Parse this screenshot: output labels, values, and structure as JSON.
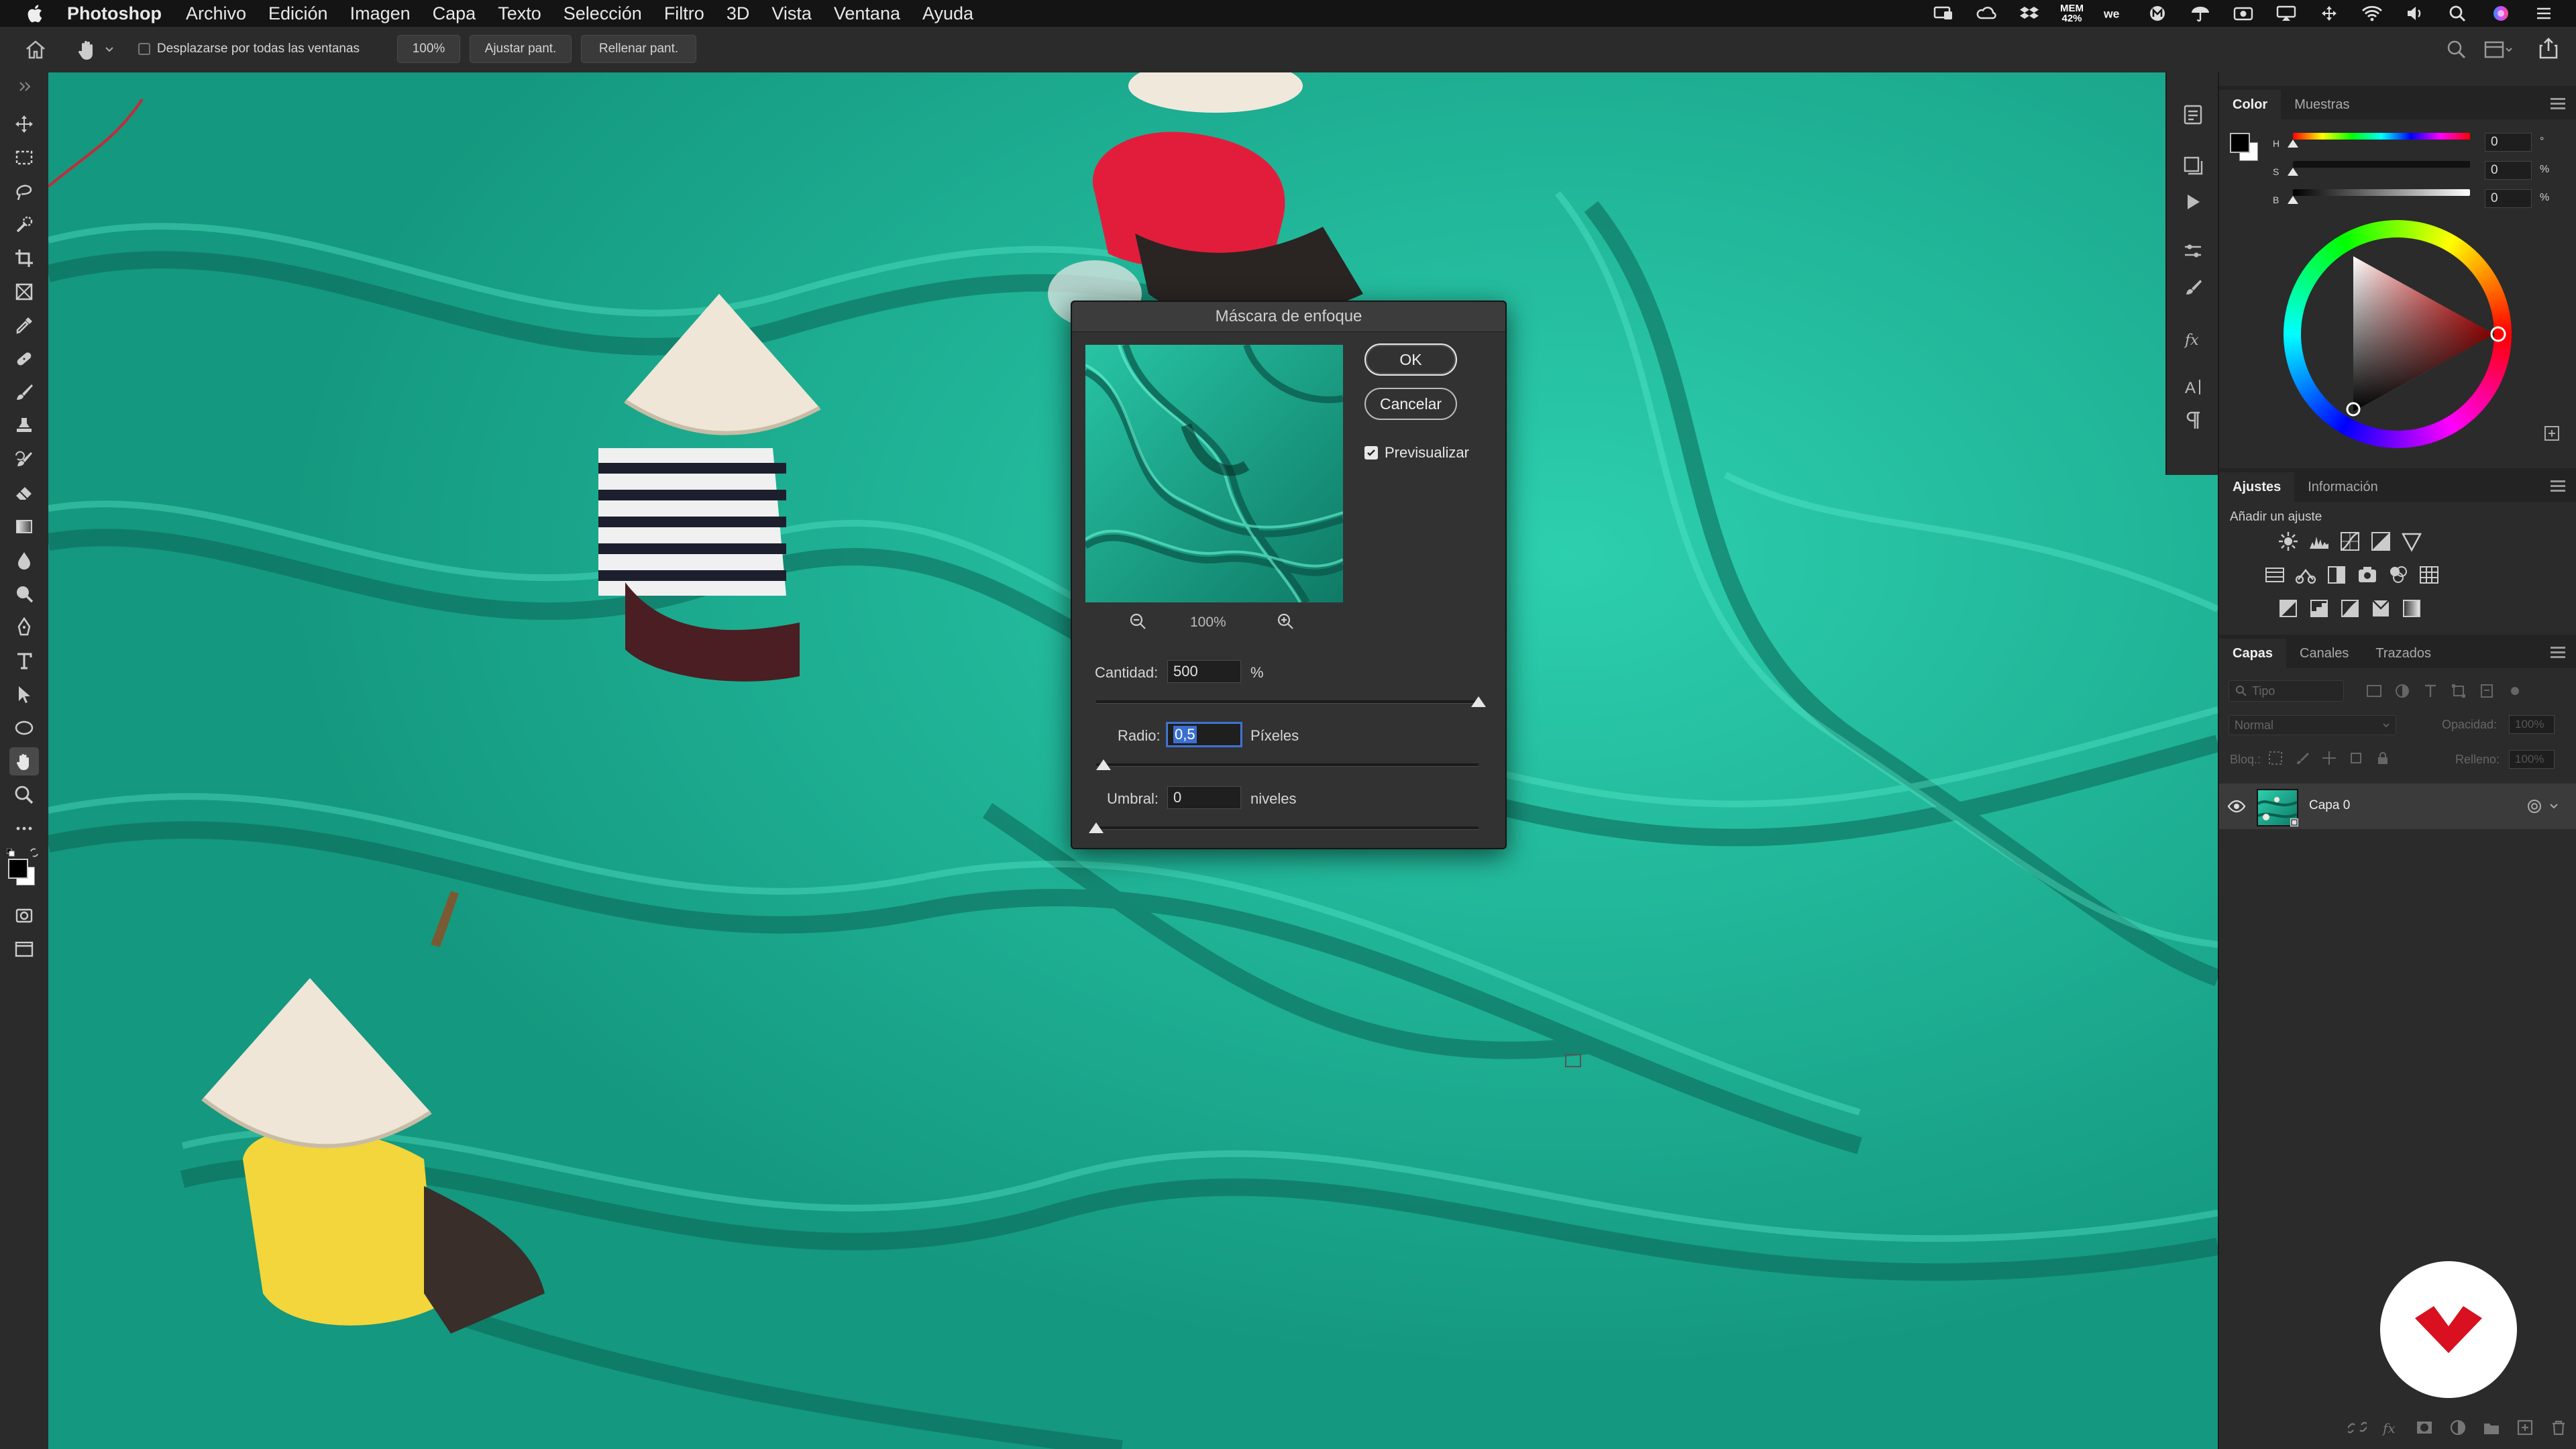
{
  "menubar": {
    "app_name": "Photoshop",
    "items": [
      "Archivo",
      "Edición",
      "Imagen",
      "Capa",
      "Texto",
      "Selección",
      "Filtro",
      "3D",
      "Vista",
      "Ventana",
      "Ayuda"
    ],
    "memory_label": "MEM",
    "memory_value": "42%"
  },
  "options_bar": {
    "scroll_all_label": "Desplazarse por todas las ventanas",
    "zoom_value": "100%",
    "fit_screen_label": "Ajustar pant.",
    "fill_screen_label": "Rellenar pant."
  },
  "color_panel": {
    "tabs": [
      "Color",
      "Muestras"
    ],
    "sliders": [
      {
        "letter": "H",
        "value": "0",
        "unit": "°"
      },
      {
        "letter": "S",
        "value": "0",
        "unit": "%"
      },
      {
        "letter": "B",
        "value": "0",
        "unit": "%"
      }
    ]
  },
  "adjustments_panel": {
    "tabs": [
      "Ajustes",
      "Información"
    ],
    "add_label": "Añadir un ajuste"
  },
  "layers_panel": {
    "tabs": [
      "Capas",
      "Canales",
      "Trazados"
    ],
    "filter_placeholder": "Tipo",
    "blend_mode": "Normal",
    "opacity_label": "Opacidad:",
    "opacity_value": "100%",
    "lock_label": "Bloq.:",
    "fill_label": "Relleno:",
    "fill_value": "100%",
    "layers": [
      {
        "name": "Capa 0",
        "visible": true
      }
    ]
  },
  "dialog": {
    "title": "Máscara de enfoque",
    "ok_label": "OK",
    "cancel_label": "Cancelar",
    "preview_label": "Previsualizar",
    "preview_checked": true,
    "preview_zoom": "100%",
    "amount_label": "Cantidad:",
    "amount_value": "500",
    "amount_unit": "%",
    "amount_fraction": 1.0,
    "radius_label": "Radio:",
    "radius_value": "0,5",
    "radius_unit": "Píxeles",
    "radius_fraction": 0.02,
    "threshold_label": "Umbral:",
    "threshold_value": "0",
    "threshold_unit": "niveles",
    "threshold_fraction": 0.0
  },
  "colors": {
    "net_teal": "#1aa58e",
    "net_dark": "#0c6b5c",
    "panel_bg": "#2b2b2b",
    "logo_red": "#d8101f"
  }
}
